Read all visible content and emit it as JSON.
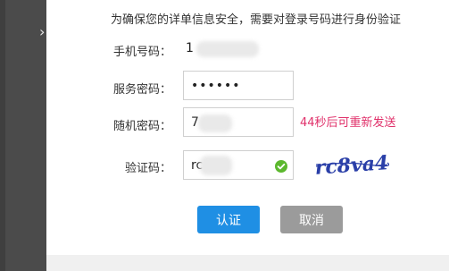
{
  "notice": "为确保您的详单信息安全，需要对登录号码进行身份验证",
  "form": {
    "phone": {
      "label": "手机号码：",
      "value": "1"
    },
    "service_password": {
      "label": "服务密码：",
      "value": "••••••"
    },
    "random_password": {
      "label": "随机密码：",
      "value": "7",
      "countdown": "44秒后可重新发送"
    },
    "captcha_field": {
      "label": "验证码：",
      "value": "rc",
      "captcha_text": "rc8va4"
    }
  },
  "buttons": {
    "confirm": "认证",
    "cancel": "取消"
  },
  "icons": {
    "back": "chevron-right-icon",
    "valid": "check-circle-icon"
  },
  "colors": {
    "confirm_bg": "#1f8fe4",
    "cancel_bg": "#9b9b9b",
    "countdown": "#e0306a",
    "valid": "#5cb82e",
    "captcha": "#2a3fa8"
  }
}
